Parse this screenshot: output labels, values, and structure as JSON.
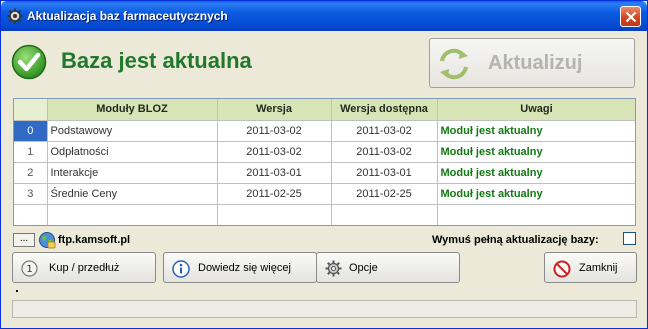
{
  "window": {
    "title": "Aktualizacja baz farmaceutycznych"
  },
  "status": {
    "text": "Baza jest aktualna"
  },
  "update_button": {
    "label": "Aktualizuj",
    "enabled": false
  },
  "table": {
    "columns": [
      "Moduły BLOZ",
      "Wersja",
      "Wersja dostępna",
      "Uwagi"
    ],
    "rows": [
      {
        "index": "0",
        "module": "Podstawowy",
        "version": "2011-03-02",
        "available": "2011-03-02",
        "note": "Moduł jest aktualny"
      },
      {
        "index": "1",
        "module": "Odpłatności",
        "version": "2011-03-02",
        "available": "2011-03-02",
        "note": "Moduł jest aktualny"
      },
      {
        "index": "2",
        "module": "Interakcje",
        "version": "2011-03-01",
        "available": "2011-03-01",
        "note": "Moduł jest aktualny"
      },
      {
        "index": "3",
        "module": "Średnie Ceny",
        "version": "2011-02-25",
        "available": "2011-02-25",
        "note": "Moduł jest aktualny"
      }
    ]
  },
  "source": {
    "dots_label": "...",
    "server": "ftp.kamsoft.pl"
  },
  "force_update": {
    "label": "Wymuś pełną aktualizację bazy:",
    "checked": false
  },
  "buttons": {
    "buy": "Kup / przedłuż",
    "info": "Dowiedz się więcej",
    "options": "Opcje",
    "close": "Zamknij"
  },
  "colors": {
    "title_bar": "#0a5ae0",
    "status_green": "#21782d",
    "header_bg": "#d7e4b5",
    "note_green": "#117a11",
    "selection": "#316ac5"
  }
}
